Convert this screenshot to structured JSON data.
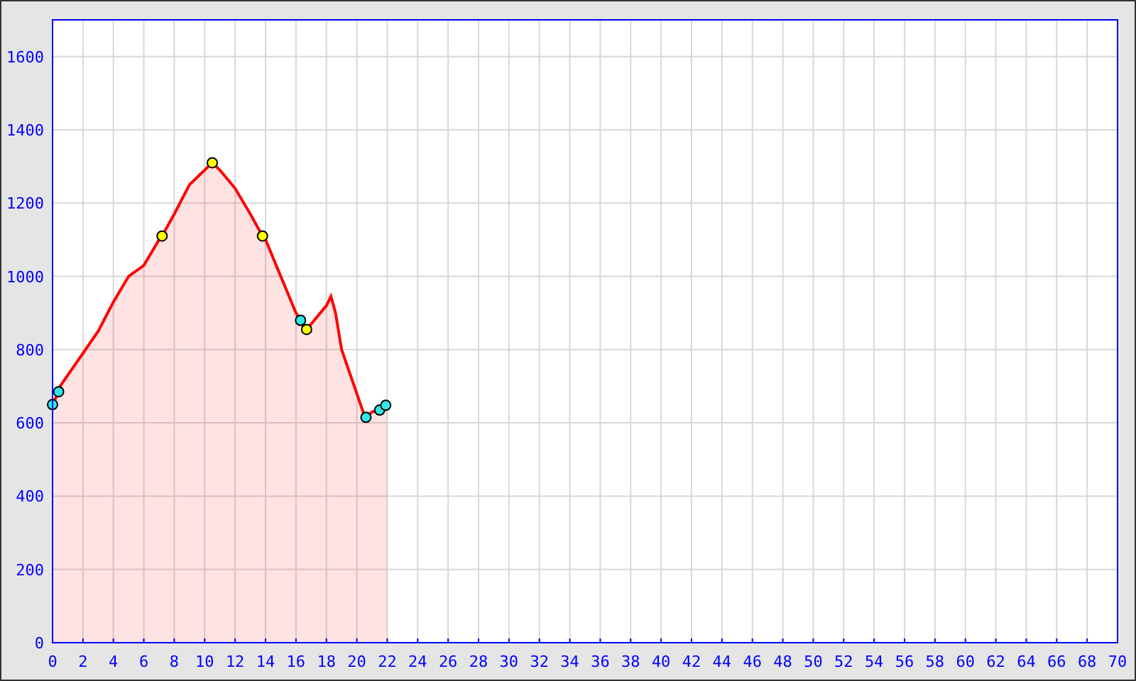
{
  "chart": {
    "chart_data": {
      "type": "area",
      "grid": true,
      "x": [
        0,
        0.4,
        0.5,
        1,
        2,
        3,
        4,
        5,
        6,
        7,
        7.2,
        8,
        9,
        10,
        10.5,
        11,
        12,
        13,
        13.8,
        14,
        15,
        16,
        16.3,
        16.5,
        16.7,
        17,
        18,
        18.3,
        18.6,
        19,
        20,
        20.5,
        20.6,
        21,
        21.5,
        21.9,
        22
      ],
      "series": [
        {
          "color": "#ff0000",
          "values": [
            650,
            685,
            700,
            730,
            790,
            850,
            930,
            1000,
            1030,
            1100,
            1110,
            1170,
            1250,
            1290,
            1310,
            1290,
            1240,
            1170,
            1110,
            1100,
            1000,
            900,
            880,
            860,
            855,
            870,
            920,
            945,
            900,
            800,
            680,
            620,
            615,
            630,
            635,
            648,
            650
          ]
        },
        {
          "type": "scatter",
          "color": "#33e6e6",
          "values": [
            650,
            685,
            null,
            null,
            null,
            null,
            null,
            null,
            null,
            null,
            null,
            null,
            null,
            null,
            null,
            null,
            null,
            null,
            null,
            null,
            null,
            null,
            880,
            null,
            null,
            null,
            null,
            null,
            null,
            null,
            null,
            null,
            615,
            null,
            635,
            648,
            null
          ]
        },
        {
          "type": "scatter",
          "color": "#ffff00",
          "values": [
            null,
            null,
            null,
            null,
            null,
            null,
            null,
            null,
            null,
            null,
            1110,
            null,
            null,
            null,
            1310,
            null,
            null,
            null,
            1110,
            null,
            null,
            null,
            null,
            null,
            855,
            null,
            null,
            null,
            null,
            null,
            null,
            null,
            null,
            null,
            null,
            null,
            null
          ]
        }
      ],
      "xlim": [
        0,
        70
      ],
      "ylim": [
        0,
        1700
      ],
      "xticks": [
        0,
        2,
        4,
        6,
        8,
        10,
        12,
        14,
        16,
        18,
        20,
        22,
        24,
        26,
        28,
        30,
        32,
        34,
        36,
        38,
        40,
        42,
        44,
        46,
        48,
        50,
        52,
        54,
        56,
        58,
        60,
        62,
        64,
        66,
        68,
        70
      ],
      "yticks": [
        0,
        200,
        400,
        600,
        800,
        1000,
        1200,
        1400,
        1600
      ]
    }
  }
}
